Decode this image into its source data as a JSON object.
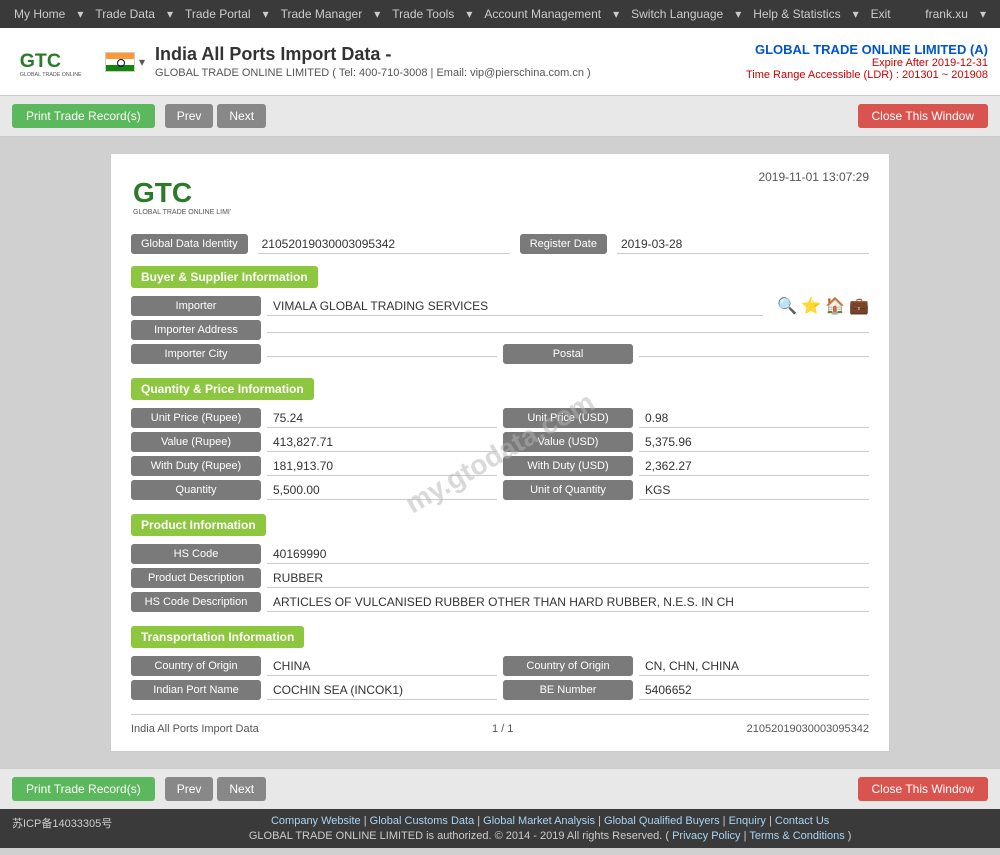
{
  "nav": {
    "items": [
      "My Home",
      "Trade Data",
      "Trade Portal",
      "Trade Manager",
      "Trade Tools",
      "Account Management",
      "Switch Language",
      "Help & Statistics",
      "Exit"
    ],
    "user": "frank.xu"
  },
  "header": {
    "title": "India All Ports Import Data  -",
    "subtitle": "GLOBAL TRADE ONLINE LIMITED ( Tel: 400-710-3008 | Email: vip@pierschina.com.cn )",
    "company_name": "GLOBAL TRADE ONLINE LIMITED (A)",
    "expire": "Expire After 2019-12-31",
    "time_range": "Time Range Accessible (LDR) : 201301 ~ 201908"
  },
  "toolbar": {
    "print_label": "Print Trade Record(s)",
    "prev_label": "Prev",
    "next_label": "Next",
    "close_label": "Close This Window"
  },
  "record": {
    "datetime": "2019-11-01 13:07:29",
    "global_data_identity_label": "Global Data Identity",
    "global_data_identity_value": "21052019030003095342",
    "register_date_label": "Register Date",
    "register_date_value": "2019-03-28",
    "sections": {
      "buyer_supplier": {
        "title": "Buyer & Supplier Information",
        "importer_label": "Importer",
        "importer_value": "VIMALA GLOBAL TRADING SERVICES",
        "importer_address_label": "Importer Address",
        "importer_address_value": "",
        "importer_city_label": "Importer City",
        "importer_city_value": "",
        "postal_label": "Postal",
        "postal_value": ""
      },
      "quantity_price": {
        "title": "Quantity & Price Information",
        "fields": [
          {
            "label": "Unit Price (Rupee)",
            "value": "75.24",
            "label2": "Unit Price (USD)",
            "value2": "0.98"
          },
          {
            "label": "Value (Rupee)",
            "value": "413,827.71",
            "label2": "Value (USD)",
            "value2": "5,375.96"
          },
          {
            "label": "With Duty (Rupee)",
            "value": "181,913.70",
            "label2": "With Duty (USD)",
            "value2": "2,362.27"
          },
          {
            "label": "Quantity",
            "value": "5,500.00",
            "label2": "Unit of Quantity",
            "value2": "KGS"
          }
        ]
      },
      "product": {
        "title": "Product Information",
        "hs_code_label": "HS Code",
        "hs_code_value": "40169990",
        "product_desc_label": "Product Description",
        "product_desc_value": "RUBBER",
        "hs_code_desc_label": "HS Code Description",
        "hs_code_desc_value": "ARTICLES OF VULCANISED RUBBER OTHER THAN HARD RUBBER, N.E.S. IN CH"
      },
      "transportation": {
        "title": "Transportation Information",
        "fields": [
          {
            "label": "Country of Origin",
            "value": "CHINA",
            "label2": "Country of Origin",
            "value2": "CN, CHN, CHINA"
          },
          {
            "label": "Indian Port Name",
            "value": "COCHIN SEA (INCOK1)",
            "label2": "BE Number",
            "value2": "5406652"
          }
        ]
      }
    },
    "footer": {
      "left": "India All Ports Import Data",
      "center": "1 / 1",
      "right": "21052019030003095342"
    }
  },
  "site_footer": {
    "icp": "苏ICP备14033305号",
    "links": [
      "Company Website",
      "Global Customs Data",
      "Global Market Analysis",
      "Global Qualified Buyers",
      "Enquiry",
      "Contact Us"
    ],
    "copyright": "GLOBAL TRADE ONLINE LIMITED is authorized. © 2014 - 2019 All rights Reserved.",
    "policy_links": [
      "Privacy Policy",
      "Terms & Conditions"
    ]
  },
  "watermark": "my.gtodata.com"
}
